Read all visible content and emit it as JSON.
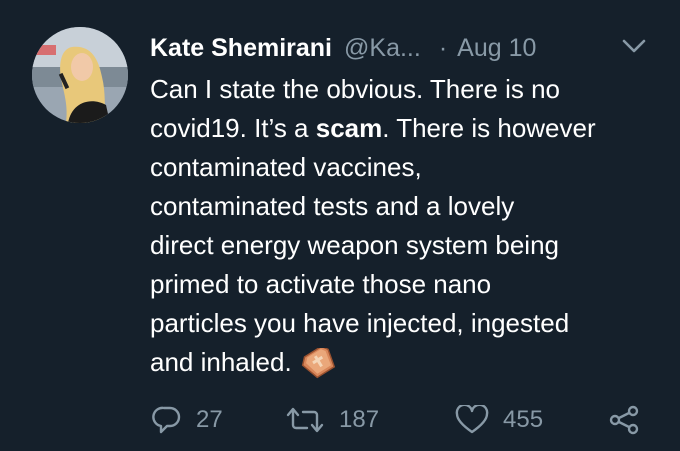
{
  "tweet": {
    "author_name": "Kate Shemirani",
    "author_handle": "@Ka...",
    "separator": "·",
    "date": "Aug 10",
    "text_lines": [
      "Can I state the obvious. There is no",
      "covid19. It’s a ",
      "contaminated vaccines,",
      "contaminated tests and a lovely",
      "direct energy weapon system being",
      "primed to activate those nano",
      "particles you have injected, ingested",
      "and inhaled."
    ],
    "bold_word": "scam",
    "after_bold": ". There is however",
    "emoji": "coffin-emoji",
    "actions": {
      "reply_count": "27",
      "retweet_count": "187",
      "like_count": "455"
    }
  },
  "colors": {
    "background": "#15202b",
    "text": "#ffffff",
    "secondary": "#8899a6"
  },
  "icons": {
    "menu": "chevron-down-icon",
    "reply": "reply-icon",
    "retweet": "retweet-icon",
    "like": "heart-icon",
    "share": "share-icon"
  }
}
